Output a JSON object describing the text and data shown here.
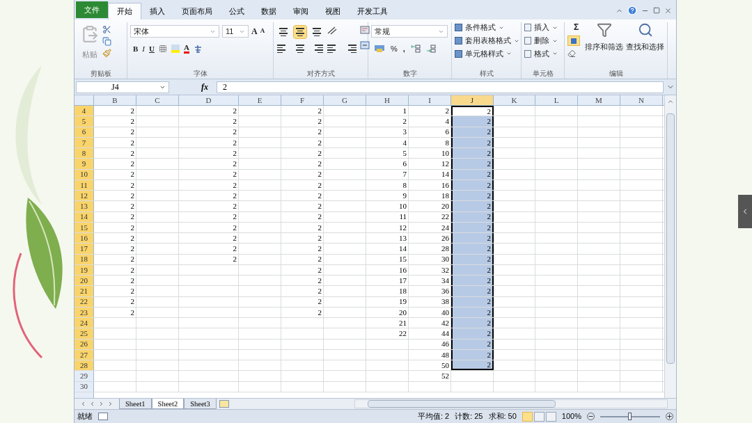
{
  "tabs": [
    {
      "label": "文件",
      "kind": "file",
      "selected": false
    },
    {
      "label": "开始",
      "kind": "tab",
      "selected": true
    },
    {
      "label": "插入",
      "kind": "tab",
      "selected": false
    },
    {
      "label": "页面布局",
      "kind": "tab",
      "selected": false
    },
    {
      "label": "公式",
      "kind": "tab",
      "selected": false
    },
    {
      "label": "数据",
      "kind": "tab",
      "selected": false
    },
    {
      "label": "审阅",
      "kind": "tab",
      "selected": false
    },
    {
      "label": "视图",
      "kind": "tab",
      "selected": false
    },
    {
      "label": "开发工具",
      "kind": "tab",
      "selected": false
    }
  ],
  "ribbon": {
    "clipboard": {
      "label": "剪贴板",
      "paste": "粘贴"
    },
    "font": {
      "label": "字体",
      "font": "宋体",
      "size": "11",
      "grow": "A",
      "shrink": "A",
      "bold": "B",
      "italic": "I",
      "underline": "U",
      "font_color_letter": "A"
    },
    "alignment": {
      "label": "对齐方式",
      "vertical": [
        {
          "selected": false
        },
        {
          "selected": true
        },
        {
          "selected": false
        }
      ]
    },
    "number": {
      "label": "数字",
      "format": "常规",
      "percent": "%",
      "comma": ","
    },
    "styles": {
      "label": "样式",
      "items": [
        "条件格式",
        "套用表格格式",
        "单元格样式"
      ]
    },
    "cells": {
      "label": "单元格",
      "items": [
        "插入",
        "删除",
        "格式"
      ]
    },
    "editing": {
      "label": "编辑",
      "sum": "Σ",
      "items": [
        "排序和筛选",
        "查找和选择"
      ]
    }
  },
  "formula_bar": {
    "name_box": "J4",
    "function_label": "fx",
    "formula": "2"
  },
  "columns": [
    {
      "label": "B",
      "selected": false,
      "values": [
        "2",
        "2",
        "2",
        "2",
        "2",
        "2",
        "2",
        "2",
        "2",
        "2",
        "2",
        "2",
        "2",
        "2",
        "2",
        "2",
        "2",
        "2",
        "2",
        "2"
      ]
    },
    {
      "label": "C",
      "selected": false
    },
    {
      "label": "D",
      "selected": false,
      "values": [
        "2",
        "2",
        "2",
        "2",
        "2",
        "2",
        "2",
        "2",
        "2",
        "2",
        "2",
        "2",
        "2",
        "2",
        "2"
      ]
    },
    {
      "label": "E",
      "selected": false
    },
    {
      "label": "F",
      "selected": false,
      "values": [
        "2",
        "2",
        "2",
        "2",
        "2",
        "2",
        "2",
        "2",
        "2",
        "2",
        "2",
        "2",
        "2",
        "2",
        "2",
        "2",
        "2",
        "2",
        "2",
        "2"
      ]
    },
    {
      "label": "G",
      "selected": false
    },
    {
      "label": "H",
      "selected": false,
      "values": [
        "1",
        "2",
        "3",
        "4",
        "5",
        "6",
        "7",
        "8",
        "9",
        "10",
        "11",
        "12",
        "13",
        "14",
        "15",
        "16",
        "17",
        "18",
        "19",
        "20",
        "21",
        "22"
      ]
    },
    {
      "label": "I",
      "selected": false,
      "values": [
        "2",
        "4",
        "6",
        "8",
        "10",
        "12",
        "14",
        "16",
        "18",
        "20",
        "22",
        "24",
        "26",
        "28",
        "30",
        "32",
        "34",
        "36",
        "38",
        "40",
        "42",
        "44",
        "46",
        "48",
        "50",
        "52"
      ]
    },
    {
      "label": "J",
      "selected": true,
      "values": [
        "2",
        "2",
        "2",
        "2",
        "2",
        "2",
        "2",
        "2",
        "2",
        "2",
        "2",
        "2",
        "2",
        "2",
        "2",
        "2",
        "2",
        "2",
        "2",
        "2",
        "2",
        "2",
        "2",
        "2",
        "2"
      ]
    },
    {
      "label": "K",
      "selected": false
    },
    {
      "label": "L",
      "selected": false
    },
    {
      "label": "M",
      "selected": false
    },
    {
      "label": "N",
      "selected": false
    }
  ],
  "rows": [
    {
      "label": "4",
      "selected": true
    },
    {
      "label": "5",
      "selected": true
    },
    {
      "label": "6",
      "selected": true
    },
    {
      "label": "7",
      "selected": true
    },
    {
      "label": "8",
      "selected": true
    },
    {
      "label": "9",
      "selected": true
    },
    {
      "label": "10",
      "selected": true
    },
    {
      "label": "11",
      "selected": true
    },
    {
      "label": "12",
      "selected": true
    },
    {
      "label": "13",
      "selected": true
    },
    {
      "label": "14",
      "selected": true
    },
    {
      "label": "15",
      "selected": true
    },
    {
      "label": "16",
      "selected": true
    },
    {
      "label": "17",
      "selected": true
    },
    {
      "label": "18",
      "selected": true
    },
    {
      "label": "19",
      "selected": true
    },
    {
      "label": "20",
      "selected": true
    },
    {
      "label": "21",
      "selected": true
    },
    {
      "label": "22",
      "selected": true
    },
    {
      "label": "23",
      "selected": true
    },
    {
      "label": "24",
      "selected": true
    },
    {
      "label": "25",
      "selected": true
    },
    {
      "label": "26",
      "selected": true
    },
    {
      "label": "27",
      "selected": true
    },
    {
      "label": "28",
      "selected": true
    },
    {
      "label": "29",
      "selected": false
    },
    {
      "label": "30",
      "selected": false
    }
  ],
  "sheets": [
    {
      "label": "Sheet1",
      "selected": false
    },
    {
      "label": "Sheet2",
      "selected": true
    },
    {
      "label": "Sheet3",
      "selected": false
    }
  ],
  "status_bar": {
    "ready": "就绪",
    "average": "平均值: 2",
    "count": "计数: 25",
    "sum": "求和: 50",
    "views": [
      {
        "selected": true
      },
      {
        "selected": false
      },
      {
        "selected": false
      }
    ],
    "zoom": "100%",
    "level": 0.5
  }
}
